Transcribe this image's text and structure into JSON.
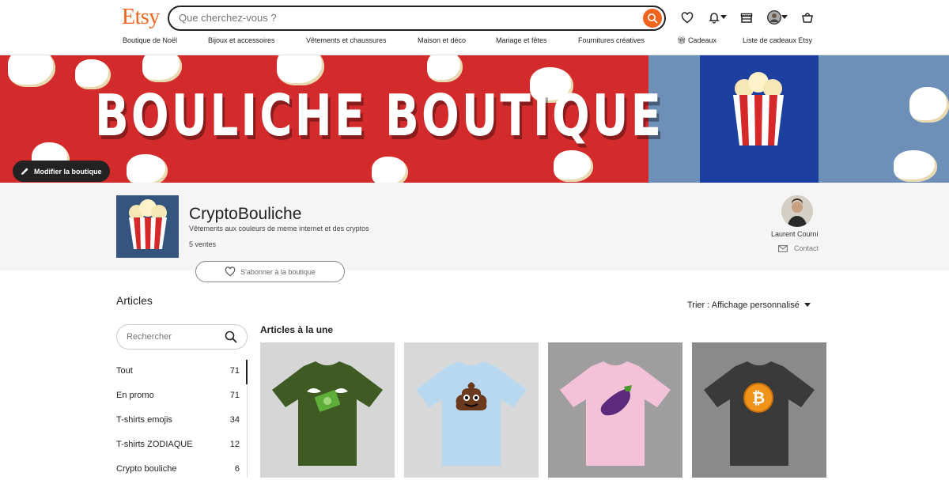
{
  "header": {
    "logo": "Etsy",
    "search_placeholder": "Que cherchez-vous ?",
    "icons": [
      "search-icon",
      "heart-icon",
      "bell-icon",
      "gift-icon",
      "avatar",
      "cart-icon"
    ]
  },
  "nav": {
    "items": [
      "Boutique de Noël",
      "Bijoux et accessoires",
      "Vêtements et chaussures",
      "Maison et déco",
      "Mariage et fêtes",
      "Fournitures créatives",
      "Cadeaux",
      "Liste de cadeaux Etsy"
    ]
  },
  "banner": {
    "title": "BOULICHE BOUTIQUE",
    "edit_label": "Modifier la boutique"
  },
  "shop": {
    "name": "CryptoBouliche",
    "description": "Vêtements aux couleurs de meme internet et des cryptos",
    "sales": "5 ventes",
    "follow_label": "S'abonner à la boutique"
  },
  "owner": {
    "name": "Laurent Courni",
    "contact_label": "Contact"
  },
  "articles": {
    "title": "Articles",
    "sort_label": "Trier : Affichage personnalisé",
    "search_placeholder": "Rechercher",
    "featured_title": "Articles à la une",
    "categories": [
      {
        "label": "Tout",
        "count": "71"
      },
      {
        "label": "En promo",
        "count": "71"
      },
      {
        "label": "T-shirts emojis",
        "count": "34"
      },
      {
        "label": "T-shirts ZODIAQUE",
        "count": "12"
      },
      {
        "label": "Crypto bouliche",
        "count": "6"
      }
    ],
    "products": [
      {
        "shirt_color": "#3f5a22",
        "emoji": "money-with-wings-icon"
      },
      {
        "shirt_color": "#b7d8ee",
        "emoji": "poop-icon"
      },
      {
        "shirt_color": "#f3c2d6",
        "emoji": "eggplant-icon"
      },
      {
        "shirt_color": "#3a3a3a",
        "emoji": "bitcoin-icon"
      }
    ]
  },
  "colors": {
    "accent": "#f1641e",
    "banner_red": "#d32b2b",
    "dark": "#222222"
  }
}
